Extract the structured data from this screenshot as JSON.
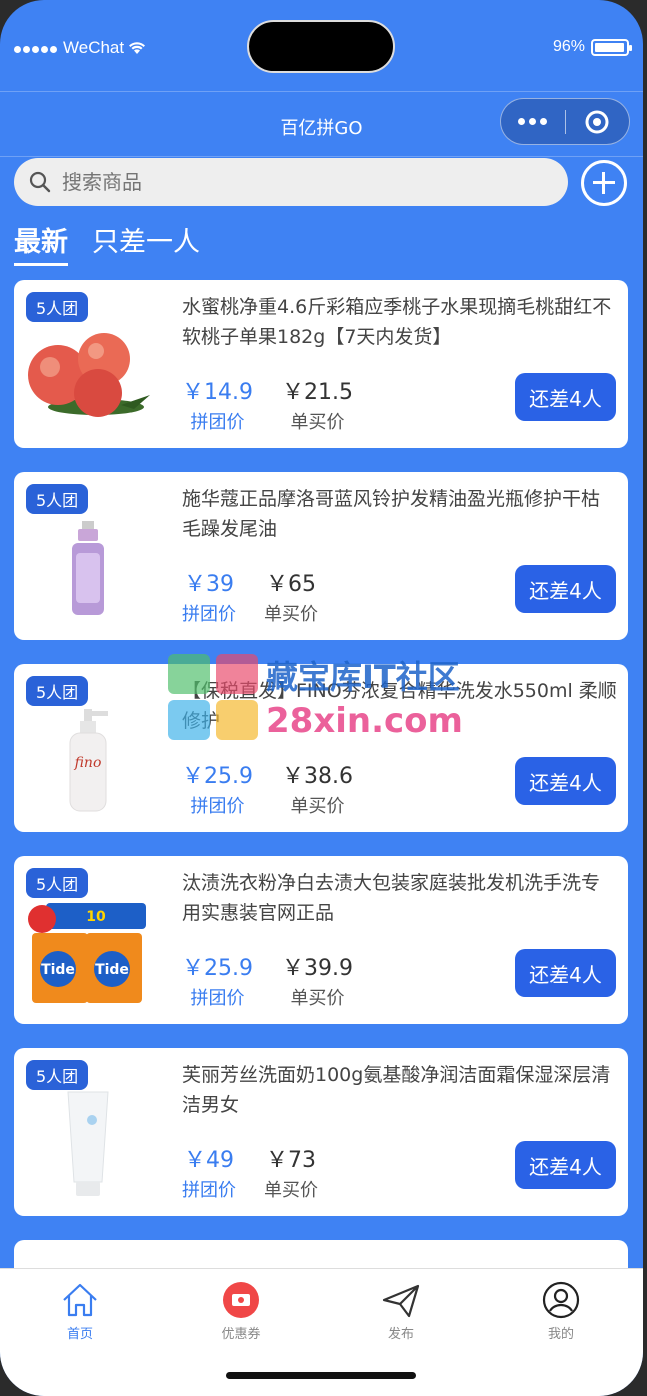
{
  "status_bar": {
    "carrier": "WeChat",
    "battery": "96%",
    "battery_level": 0.96
  },
  "nav": {
    "title": "百亿拼GO"
  },
  "search": {
    "placeholder": "搜索商品"
  },
  "tabs": [
    {
      "label": "最新",
      "active": true
    },
    {
      "label": "只差一人",
      "active": false
    }
  ],
  "products": [
    {
      "badge": "5人团",
      "name": "水蜜桃净重4.6斤彩箱应季桃子水果现摘毛桃甜红不软桃子单果182g【7天内发货】",
      "group_price": "￥14.9",
      "group_label": "拼团价",
      "single_price": "￥21.5",
      "single_label": "单买价",
      "button": "还差4人",
      "image": "peach"
    },
    {
      "badge": "5人团",
      "name": "施华蔻正品摩洛哥蓝风铃护发精油盈光瓶修护干枯毛躁发尾油",
      "group_price": "￥39",
      "group_label": "拼团价",
      "single_price": "￥65",
      "single_label": "单买价",
      "button": "还差4人",
      "image": "hair-oil"
    },
    {
      "badge": "5人团",
      "name": "【保税直发】FINO芬浓复合精华洗发水550ml 柔顺修护",
      "group_price": "￥25.9",
      "group_label": "拼团价",
      "single_price": "￥38.6",
      "single_label": "单买价",
      "button": "还差4人",
      "image": "shampoo"
    },
    {
      "badge": "5人团",
      "name": "汰渍洗衣粉净白去渍大包装家庭装批发机洗手洗专用实惠装官网正品",
      "group_price": "￥25.9",
      "group_label": "拼团价",
      "single_price": "￥39.9",
      "single_label": "单买价",
      "button": "还差4人",
      "image": "detergent"
    },
    {
      "badge": "5人团",
      "name": "芙丽芳丝洗面奶100g氨基酸净润洁面霜保湿深层清洁男女",
      "group_price": "￥49",
      "group_label": "拼团价",
      "single_price": "￥73",
      "single_label": "单买价",
      "button": "还差4人",
      "image": "cleanser"
    }
  ],
  "watermark": {
    "line1": "藏宝库IT社区",
    "line2": "28xin.com"
  },
  "tabbar": [
    {
      "label": "首页",
      "icon": "home-icon",
      "active": true
    },
    {
      "label": "优惠券",
      "icon": "coupon-icon",
      "active": false
    },
    {
      "label": "发布",
      "icon": "send-icon",
      "active": false
    },
    {
      "label": "我的",
      "icon": "user-icon",
      "active": false
    }
  ],
  "colors": {
    "primary": "#3f82f3",
    "button": "#2a62e6",
    "price": "#3a7df0"
  }
}
